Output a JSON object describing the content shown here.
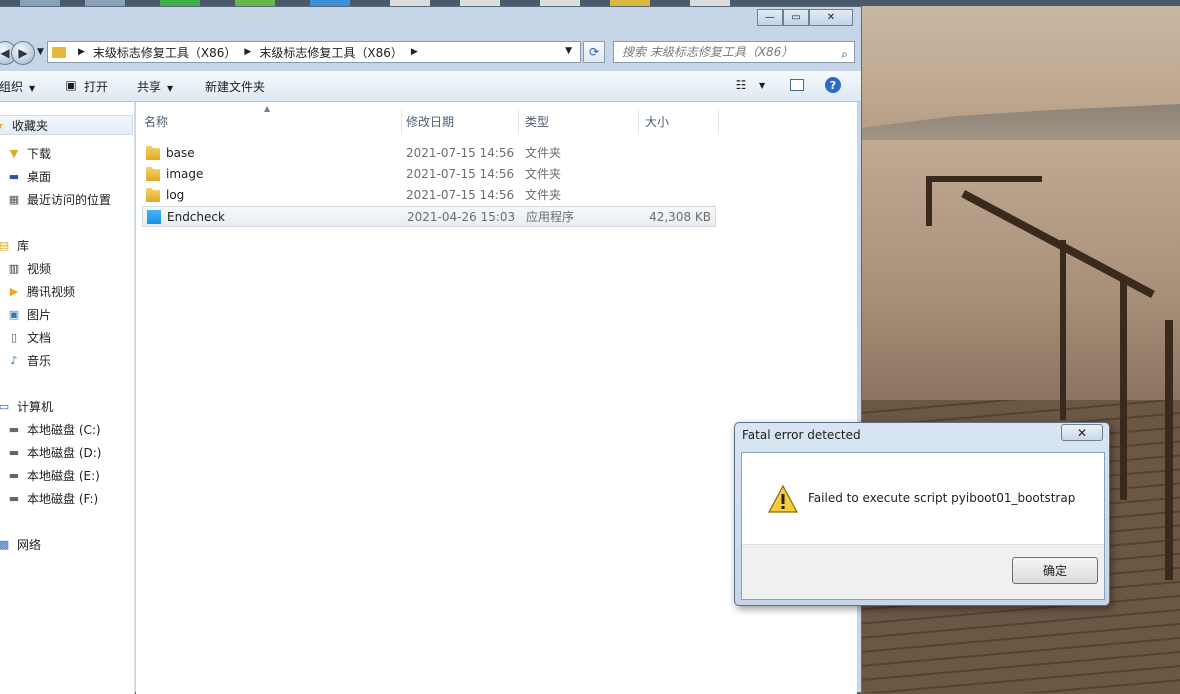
{
  "explorer": {
    "address": {
      "crumbs": [
        "末级标志修复工具（X86）",
        "末级标志修复工具（X86）"
      ]
    },
    "search": {
      "placeholder": "搜索 末级标志修复工具（X86）"
    },
    "toolbar": {
      "organize": "组织",
      "open": "打开",
      "share": "共享",
      "new_folder": "新建文件夹"
    },
    "sidebar": {
      "favorites": "收藏夹",
      "downloads": "下载",
      "desktop": "桌面",
      "recent": "最近访问的位置",
      "libraries": "库",
      "videos": "视频",
      "tencent_video": "腾讯视频",
      "pictures": "图片",
      "documents": "文档",
      "music": "音乐",
      "computer": "计算机",
      "drive_c": "本地磁盘 (C:)",
      "drive_d": "本地磁盘 (D:)",
      "drive_e": "本地磁盘 (E:)",
      "drive_f": "本地磁盘 (F:)",
      "network": "网络"
    },
    "columns": {
      "name": "名称",
      "modified": "修改日期",
      "type": "类型",
      "size": "大小"
    },
    "files": [
      {
        "name": "base",
        "modified": "2021-07-15 14:56",
        "type": "文件夹",
        "size": "",
        "icon": "folder-icon"
      },
      {
        "name": "image",
        "modified": "2021-07-15 14:56",
        "type": "文件夹",
        "size": "",
        "icon": "folder-icon"
      },
      {
        "name": "log",
        "modified": "2021-07-15 14:56",
        "type": "文件夹",
        "size": "",
        "icon": "folder-icon"
      },
      {
        "name": "Endcheck",
        "modified": "2021-04-26 15:03",
        "type": "应用程序",
        "size": "42,308 KB",
        "icon": "application-icon"
      }
    ]
  },
  "dialog": {
    "title": "Fatal error detected",
    "message": "Failed to execute script pyiboot01_bootstrap",
    "ok_label": "确定",
    "icon": "warning-icon"
  },
  "colors": {
    "accent": "#2c6ac4",
    "folder": "#e6b73e",
    "app": "#1a8ee0",
    "window_frame": "#c6d6e8"
  }
}
